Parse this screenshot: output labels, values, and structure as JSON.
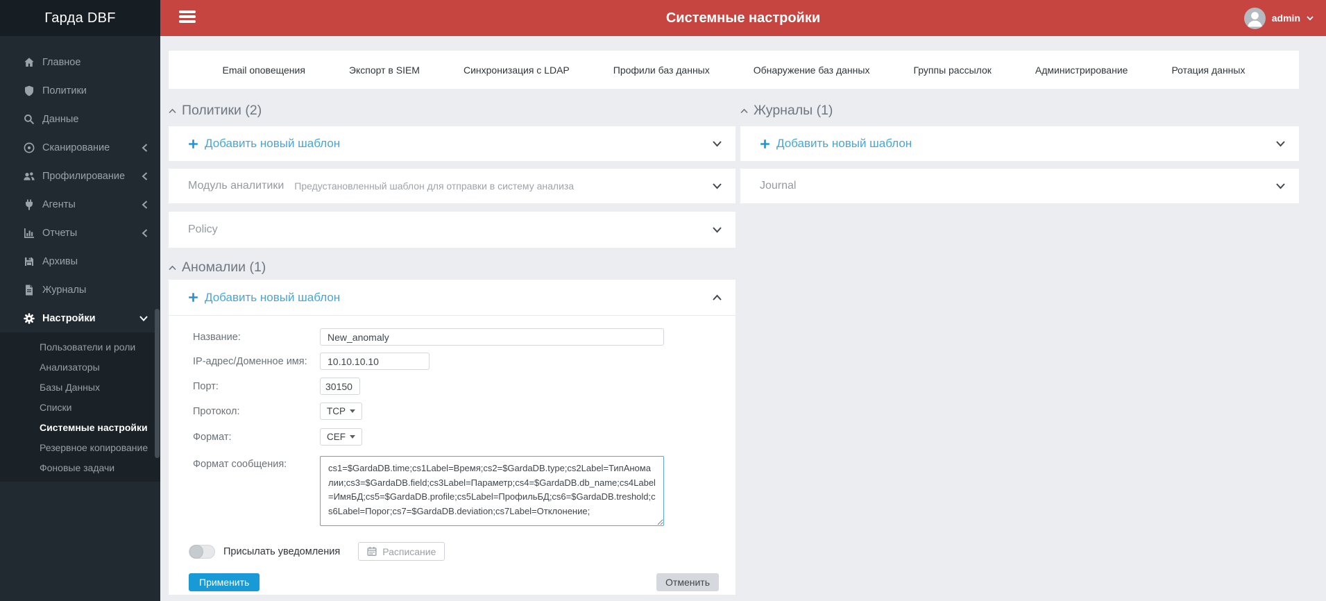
{
  "app": {
    "brand": "Гарда DBF",
    "header_title": "Системные настройки",
    "user_name": "admin"
  },
  "sidebar": {
    "items": [
      {
        "label": "Главное",
        "icon": "home-icon"
      },
      {
        "label": "Политики",
        "icon": "shield-icon"
      },
      {
        "label": "Данные",
        "icon": "search-icon"
      },
      {
        "label": "Сканирование",
        "icon": "target-icon",
        "collapsible": true
      },
      {
        "label": "Профилирование",
        "icon": "users-icon",
        "collapsible": true
      },
      {
        "label": "Агенты",
        "icon": "plug-icon",
        "collapsible": true
      },
      {
        "label": "Отчеты",
        "icon": "bar-chart-icon",
        "collapsible": true
      },
      {
        "label": "Архивы",
        "icon": "floppy-icon"
      },
      {
        "label": "Журналы",
        "icon": "file-icon"
      },
      {
        "label": "Настройки",
        "icon": "gear-icon",
        "expanded": true,
        "active": true
      }
    ],
    "settings_submenu": [
      {
        "label": "Пользователи и роли"
      },
      {
        "label": "Анализаторы"
      },
      {
        "label": "Базы Данных"
      },
      {
        "label": "Списки"
      },
      {
        "label": "Системные настройки",
        "active": true
      },
      {
        "label": "Резервное копирование"
      },
      {
        "label": "Фоновые задачи"
      }
    ]
  },
  "tabs": [
    {
      "label": "Email оповещения"
    },
    {
      "label": "Экспорт в SIEM"
    },
    {
      "label": "Синхронизация с LDAP"
    },
    {
      "label": "Профили баз данных"
    },
    {
      "label": "Обнаружение баз данных"
    },
    {
      "label": "Группы рассылок"
    },
    {
      "label": "Администрирование"
    },
    {
      "label": "Ротация данных"
    }
  ],
  "policies": {
    "title": "Политики (2)",
    "add_label": "Добавить новый шаблон",
    "panels": [
      {
        "title": "Модуль аналитики",
        "description": "Предустановленный шаблон для отправки в систему анализа"
      },
      {
        "title": "Policy"
      }
    ]
  },
  "anomalies": {
    "title": "Аномалии (1)",
    "add_label": "Добавить новый шаблон",
    "form": {
      "name": {
        "label": "Название:",
        "value": "New_anomaly"
      },
      "ip": {
        "label": "IP-адрес/Доменное имя:",
        "value": "10.10.10.10"
      },
      "port": {
        "label": "Порт:",
        "value": "30150"
      },
      "protocol": {
        "label": "Протокол:",
        "value": "TCP"
      },
      "format": {
        "label": "Формат:",
        "value": "CEF"
      },
      "message": {
        "label": "Формат сообщения:",
        "value": "cs1=$GardaDB.time;cs1Label=Время;cs2=$GardaDB.type;cs2Label=ТипАномалии;cs3=$GardaDB.field;cs3Label=Параметр;cs4=$GardaDB.db_name;cs4Label=ИмяБД;cs5=$GardaDB.profile;cs5Label=ПрофильБД;cs6=$GardaDB.treshold;cs6Label=Порог;cs7=$GardaDB.deviation;cs7Label=Отклонение;"
      },
      "notify_toggle": {
        "label": "Присылать уведомления",
        "state": "off"
      },
      "schedule_label": "Расписание",
      "apply_label": "Применить",
      "cancel_label": "Отменить"
    }
  },
  "journals": {
    "title": "Журналы (1)",
    "add_label": "Добавить новый шаблон",
    "panels": [
      {
        "title": "Journal"
      }
    ]
  },
  "colors": {
    "header_red": "#c64540",
    "sidebar_dark": "#212a31",
    "accent_blue": "#46a6d8",
    "apply_blue": "#189ad6"
  }
}
